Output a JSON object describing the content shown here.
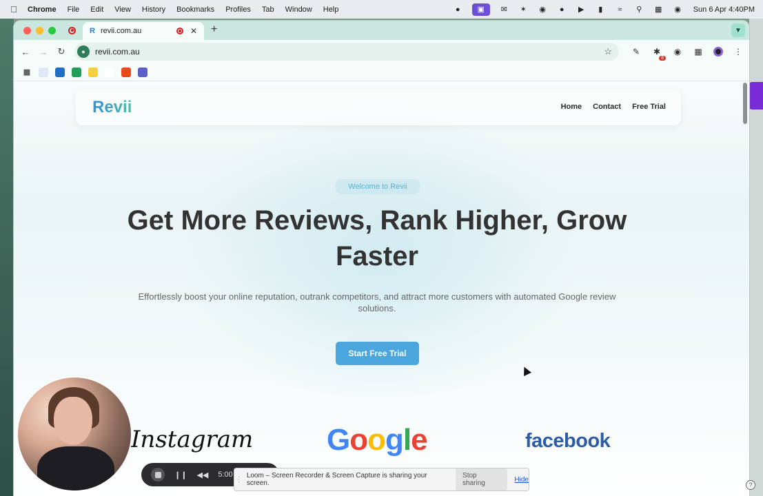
{
  "menubar": {
    "app": "Chrome",
    "items": [
      "File",
      "Edit",
      "View",
      "History",
      "Bookmarks",
      "Profiles",
      "Tab",
      "Window",
      "Help"
    ],
    "clock": "Sun 6 Apr  4:40PM"
  },
  "browser": {
    "tab_title": "revii.com.au",
    "tab_favicon": "R",
    "url": "revii.com.au",
    "extension_badge": "8"
  },
  "page": {
    "logo": "Revii",
    "nav": [
      "Home",
      "Contact",
      "Free Trial"
    ],
    "welcome": "Welcome to Revii",
    "headline": "Get More Reviews, Rank Higher, Grow Faster",
    "subheadline": "Effortlessly boost your online reputation, outrank competitors, and attract more customers with automated Google review solutions.",
    "cta": "Start Free Trial",
    "brands": {
      "instagram": "Instagram",
      "facebook": "facebook",
      "google_letters": [
        {
          "ch": "G",
          "color": "#4285F4"
        },
        {
          "ch": "o",
          "color": "#EA4335"
        },
        {
          "ch": "o",
          "color": "#FBBC05"
        },
        {
          "ch": "g",
          "color": "#4285F4"
        },
        {
          "ch": "l",
          "color": "#34A853"
        },
        {
          "ch": "e",
          "color": "#EA4335"
        }
      ]
    }
  },
  "loom": {
    "timer": "5:00",
    "share_message": "Loom – Screen Recorder & Screen Capture is sharing your screen.",
    "stop_label": "Stop sharing",
    "hide_label": "Hide"
  },
  "colors": {
    "accent": "#4aa6dc",
    "tabstrip": "#c9e7df",
    "recording": "#d02020"
  }
}
